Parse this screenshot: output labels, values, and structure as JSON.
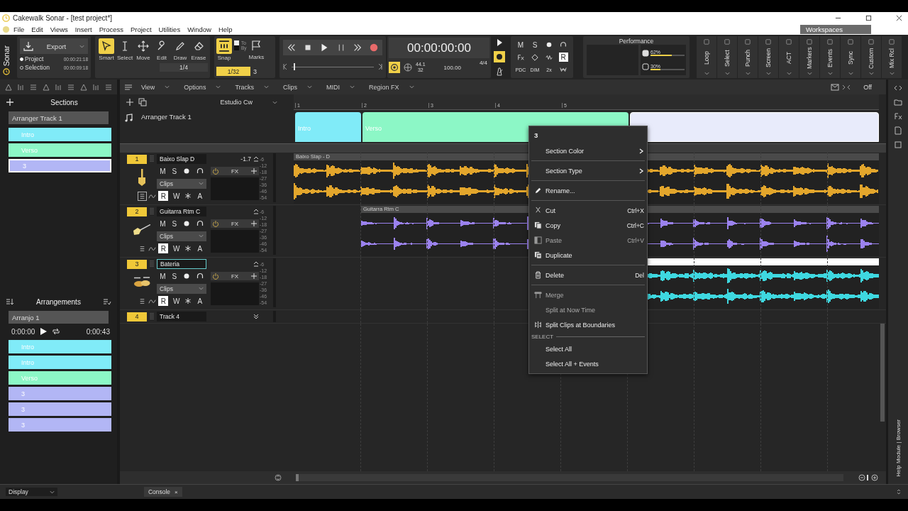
{
  "window": {
    "title": "Cakewalk Sonar - [test project*]"
  },
  "menu": [
    "File",
    "Edit",
    "Views",
    "Insert",
    "Process",
    "Project",
    "Utilities",
    "Window",
    "Help"
  ],
  "workspaces": "Workspaces",
  "control_bar": {
    "brand": "Sonar",
    "export": {
      "label": "Export",
      "ranges": [
        {
          "label": "Project",
          "time": "00:00:21:18",
          "selected": true
        },
        {
          "label": "Selection",
          "time": "00:00:09:18",
          "selected": false
        }
      ]
    },
    "tools": [
      {
        "label": "Smart",
        "selected": true
      },
      {
        "label": "Select",
        "selected": false
      },
      {
        "label": "Move",
        "selected": false
      },
      {
        "label": "Edit",
        "selected": false
      },
      {
        "label": "Draw",
        "selected": false
      },
      {
        "label": "Erase",
        "selected": false
      }
    ],
    "tool_resolution": "1/4",
    "snap": {
      "label": "Snap",
      "on": true,
      "toggle_on": true,
      "resolution": "1/32",
      "to": "To",
      "by": "By",
      "marks": "Marks",
      "marks_count": "3"
    },
    "transport": {
      "position": {
        "level": 0.03
      },
      "time": "00:00:00:00",
      "sample_rate": "44.1",
      "bit_depth": "32",
      "tempo": "100.00",
      "meter": "4/4"
    },
    "mix": {
      "mute": "M",
      "solo": "S",
      "read": "R",
      "options": [
        "PDC",
        "DIM",
        "2x"
      ]
    },
    "performance": {
      "title": "Performance",
      "meters": [
        {
          "reading": "62%",
          "level": 0.62
        },
        {
          "reading": "30%",
          "level": 0.3
        }
      ]
    },
    "modules": [
      "Loop",
      "Select",
      "Punch",
      "Screen",
      "ACT",
      "Markers",
      "Events",
      "Sync",
      "Custom",
      "Mix Rcl"
    ]
  },
  "inspector": {
    "sections": {
      "title": "Sections",
      "track": "Arranger Track 1",
      "items": [
        {
          "label": "Intro",
          "color": "#80ebf8",
          "selected": false
        },
        {
          "label": "Verso",
          "color": "#8cf7c6",
          "selected": false
        },
        {
          "label": "3",
          "color": "#b2b6f5",
          "selected": true
        }
      ]
    },
    "arrangements": {
      "title": "Arrangements",
      "arrangement": "Arranjo 1",
      "start": "0:00:00",
      "end": "0:00:43",
      "items": [
        {
          "label": "Intro",
          "color": "#80ebf8"
        },
        {
          "label": "Intro",
          "color": "#80ebf8"
        },
        {
          "label": "Verso",
          "color": "#8cf7c6"
        },
        {
          "label": "3",
          "color": "#b2b6f5"
        },
        {
          "label": "3",
          "color": "#b2b6f5"
        },
        {
          "label": "3",
          "color": "#b2b6f5"
        }
      ]
    }
  },
  "track_view": {
    "menu": [
      "View",
      "Options",
      "Tracks",
      "Clips",
      "MIDI",
      "Region FX"
    ],
    "snap_mode": "Off",
    "preset": "Estudio Cw",
    "ruler": [
      "1",
      "2",
      "3",
      "4",
      "5"
    ],
    "arranger": {
      "name": "Arranger Track 1",
      "sections": [
        {
          "label": "Intro",
          "color": "#80ebf8",
          "selected": false
        },
        {
          "label": "Verso",
          "color": "#8cf7c6",
          "selected": false
        },
        {
          "color": "#e8ebfb",
          "selected": true
        }
      ]
    },
    "tracks": [
      {
        "number": "1",
        "name": "Baixo Slap D",
        "volume": "-1.7",
        "renaming": false,
        "expanded": true,
        "buttons": [
          "M",
          "S"
        ],
        "input": "Clips",
        "fx": "FX",
        "automation": [
          "R",
          "W",
          "A"
        ],
        "scale": [
          "-6",
          "-12",
          "-18",
          "-27",
          "-36",
          "-46",
          "-54"
        ],
        "clip": {
          "name": "Baixo Slap - D",
          "color": "#e3a62c"
        }
      },
      {
        "number": "2",
        "name": "Guitarra Rtm C",
        "renaming": false,
        "expanded": true,
        "buttons": [
          "M",
          "S"
        ],
        "input": "Clips",
        "fx": "FX",
        "automation": [
          "R",
          "W",
          "A"
        ],
        "scale": [
          "-6",
          "-12",
          "-18",
          "-27",
          "-36",
          "-46",
          "-54"
        ],
        "clip": {
          "name": "Guitarra Rtm C",
          "color": "#9b82ee"
        }
      },
      {
        "number": "3",
        "name": "Bateria",
        "renaming": true,
        "expanded": true,
        "buttons": [
          "M",
          "S"
        ],
        "input": "Clips",
        "fx": "FX",
        "automation": [
          "R",
          "W",
          "A"
        ],
        "scale": [
          "-6",
          "-12",
          "-18",
          "-27",
          "-36",
          "-46",
          "-54"
        ],
        "clip": {
          "color": "#3ed8e0"
        }
      },
      {
        "number": "4",
        "name": "Track 4",
        "renaming": false,
        "expanded": false
      }
    ]
  },
  "context_menu": [
    {
      "kind": "header",
      "label": "3"
    },
    {
      "kind": "submenu",
      "label": "Section Color"
    },
    {
      "kind": "separator"
    },
    {
      "kind": "submenu",
      "label": "Section Type"
    },
    {
      "kind": "separator"
    },
    {
      "kind": "item",
      "label": "Rename...",
      "disabled": false
    },
    {
      "kind": "separator"
    },
    {
      "kind": "item",
      "label": "Cut",
      "shortcut": "Ctrl+X",
      "disabled": false
    },
    {
      "kind": "item",
      "label": "Copy",
      "shortcut": "Ctrl+C",
      "disabled": false
    },
    {
      "kind": "item",
      "label": "Paste",
      "shortcut": "Ctrl+V",
      "disabled": true
    },
    {
      "kind": "item",
      "label": "Duplicate",
      "disabled": false
    },
    {
      "kind": "separator"
    },
    {
      "kind": "item",
      "label": "Delete",
      "shortcut": "Del",
      "disabled": false
    },
    {
      "kind": "separator"
    },
    {
      "kind": "item",
      "label": "Merge",
      "disabled": true
    },
    {
      "kind": "item",
      "label": "Split at Now Time",
      "disabled": true
    },
    {
      "kind": "item",
      "label": "Split Clips at Boundaries",
      "disabled": false
    },
    {
      "kind": "group",
      "label": "SELECT"
    },
    {
      "kind": "item",
      "label": "Select All",
      "disabled": false
    },
    {
      "kind": "item",
      "label": "Select All + Events",
      "disabled": false
    }
  ],
  "bottom": {
    "display": "Display",
    "tabs": [
      {
        "label": "Console",
        "close": "×"
      }
    ],
    "side_panel": "Help Module | Browser"
  }
}
